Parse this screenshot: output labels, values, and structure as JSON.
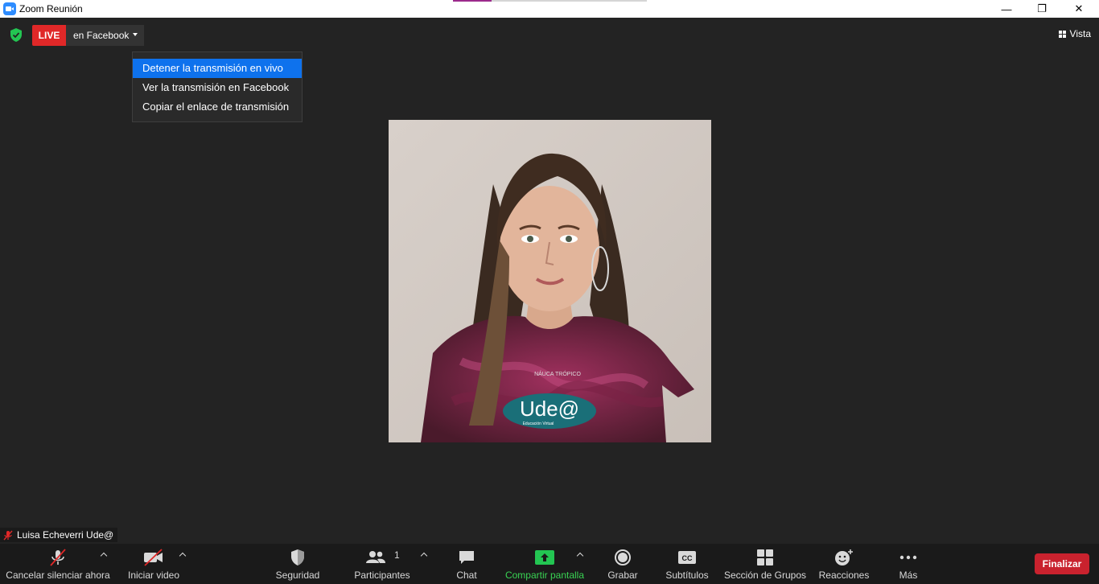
{
  "window": {
    "title": "Zoom Reunión",
    "minimize_glyph": "—",
    "restore_glyph": "❐",
    "close_glyph": "✕"
  },
  "live": {
    "badge": "LIVE",
    "target": "en Facebook"
  },
  "view": {
    "label": "Vista"
  },
  "dropdown": {
    "items": [
      "Detener la transmisión en vivo",
      "Ver la transmisión en Facebook",
      "Copiar el enlace de transmisión"
    ]
  },
  "participant": {
    "name": "Luisa Echeverri Ude@",
    "shirt_brand": "NÁUCA TRÓPICO",
    "logo_text": "Ude@",
    "logo_subtext": "Educación Virtual"
  },
  "toolbar": {
    "unmute": "Cancelar silenciar ahora",
    "start_video": "Iniciar video",
    "security": "Seguridad",
    "participants": "Participantes",
    "participants_count": "1",
    "chat": "Chat",
    "share_screen": "Compartir pantalla",
    "record": "Grabar",
    "subtitles": "Subtítulos",
    "subtitles_icon": "CC",
    "breakout": "Sección de Grupos",
    "reactions": "Reacciones",
    "more": "Más",
    "end": "Finalizar"
  },
  "colors": {
    "live_red": "#e02828",
    "menu_highlight": "#0e72ed",
    "share_green": "#39d353",
    "end_red": "#c9222e",
    "shield_green": "#23c552"
  }
}
